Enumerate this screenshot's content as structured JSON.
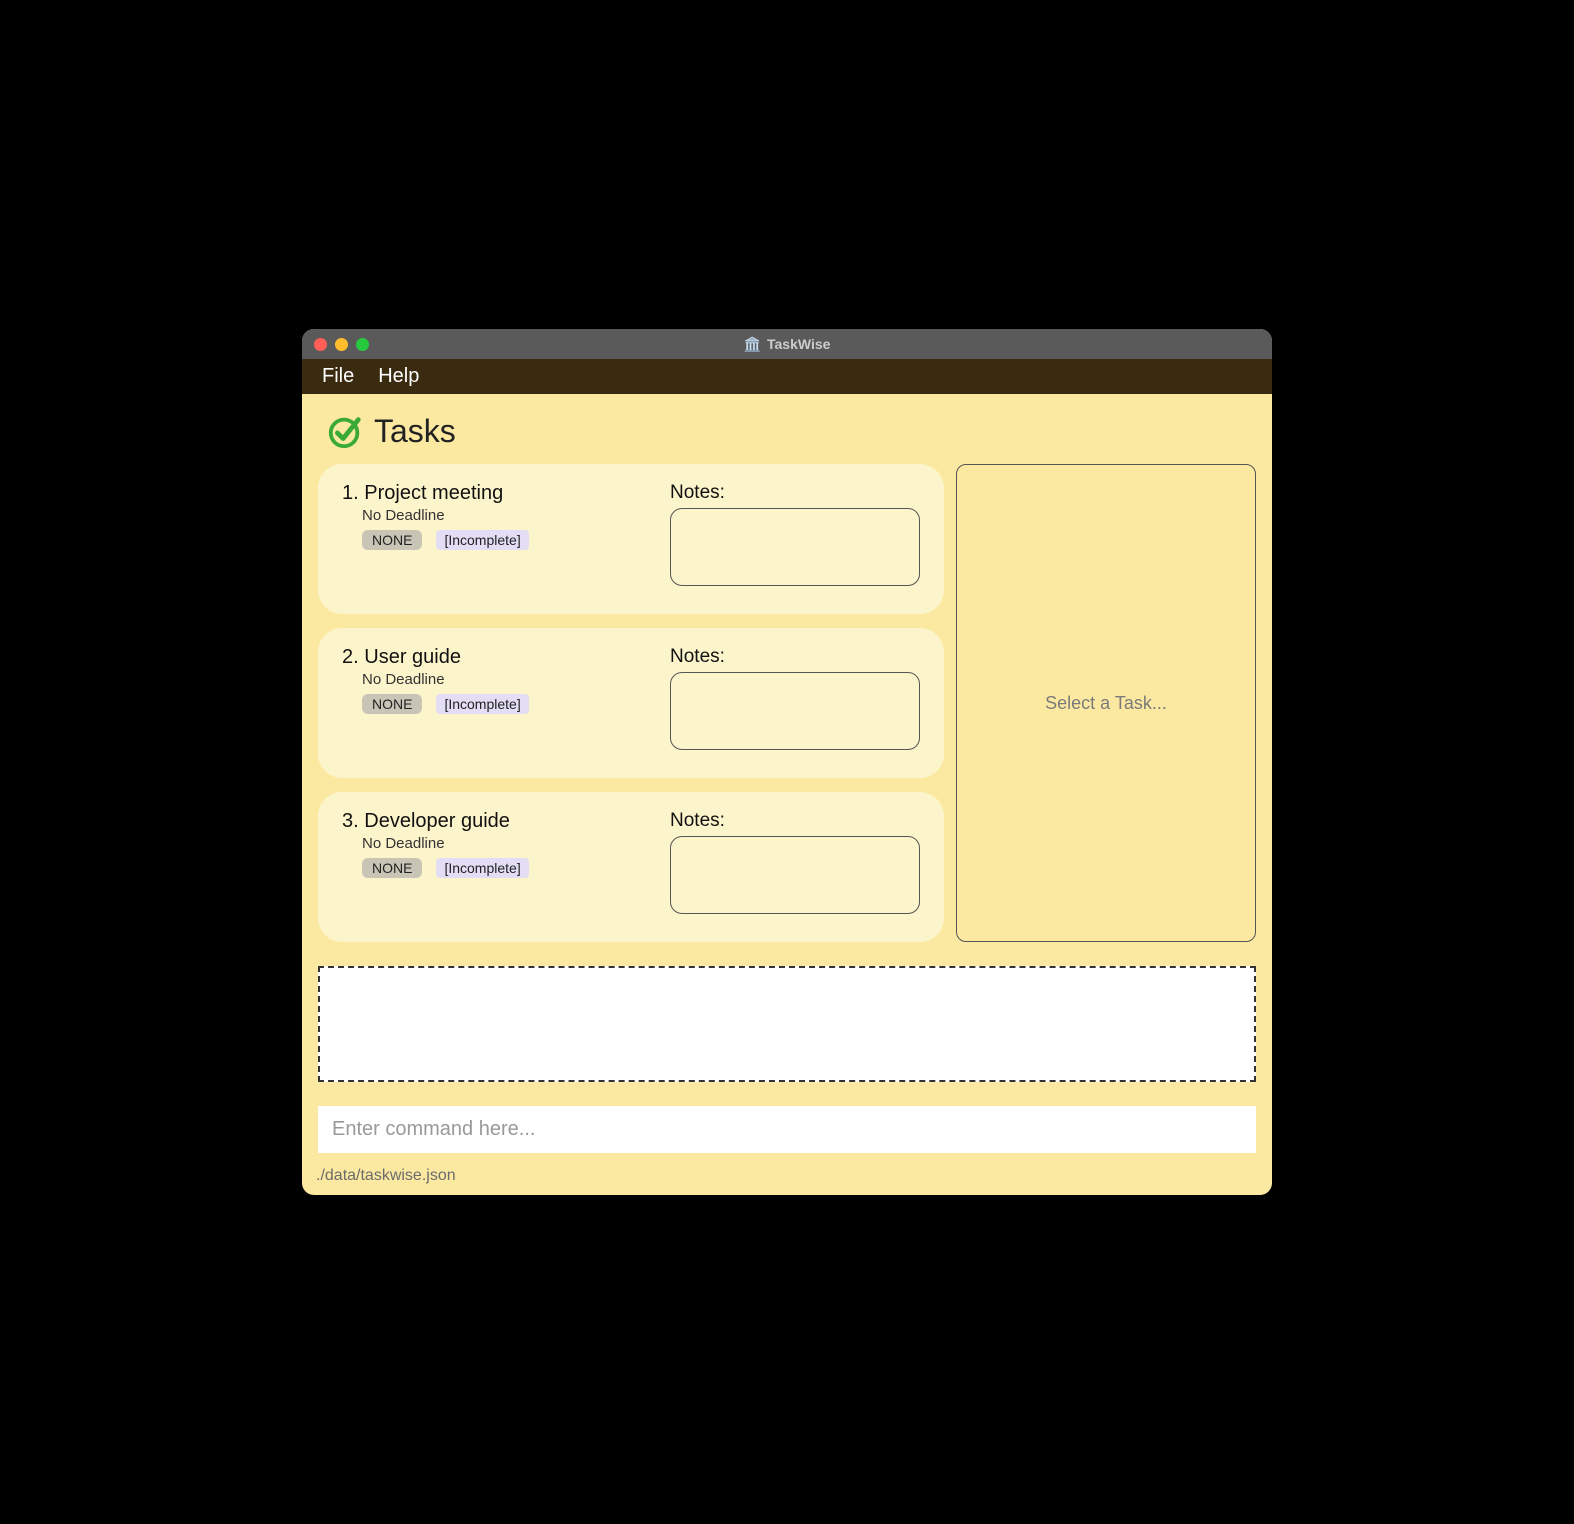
{
  "window": {
    "title": "TaskWise"
  },
  "menubar": {
    "file": "File",
    "help": "Help"
  },
  "header": {
    "title": "Tasks"
  },
  "tasks": [
    {
      "index": "1.",
      "title": "Project meeting",
      "deadline": "No Deadline",
      "priority": "NONE",
      "status": "[Incomplete]",
      "notes_label": "Notes:"
    },
    {
      "index": "2.",
      "title": "User guide",
      "deadline": "No Deadline",
      "priority": "NONE",
      "status": "[Incomplete]",
      "notes_label": "Notes:"
    },
    {
      "index": "3.",
      "title": "Developer guide",
      "deadline": "No Deadline",
      "priority": "NONE",
      "status": "[Incomplete]",
      "notes_label": "Notes:"
    }
  ],
  "detail": {
    "placeholder": "Select a Task..."
  },
  "command": {
    "placeholder": "Enter command here..."
  },
  "statusbar": {
    "path": "./data/taskwise.json"
  }
}
